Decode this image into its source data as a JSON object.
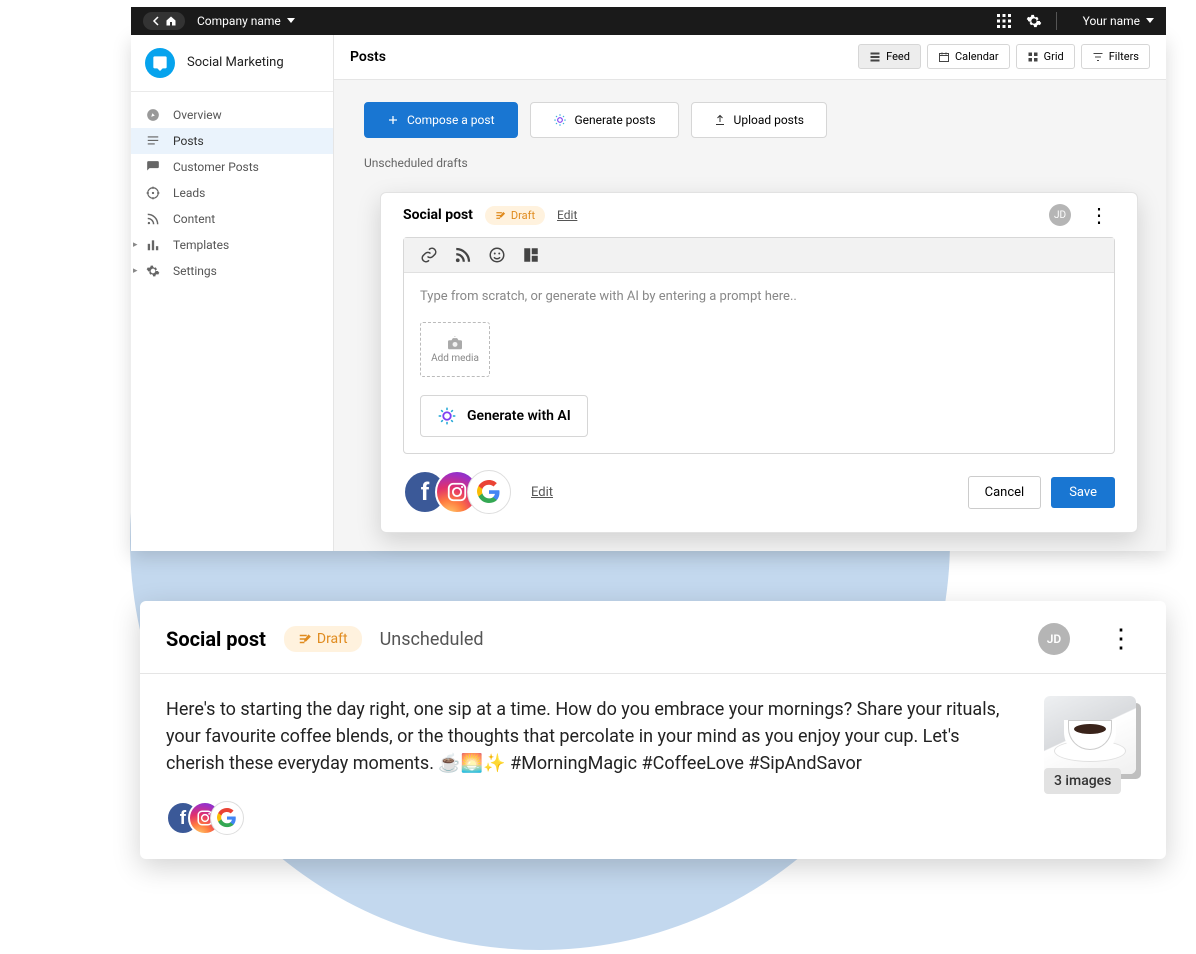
{
  "topbar": {
    "company_label": "Company name",
    "user_label": "Your name"
  },
  "sidebar": {
    "app_name": "Social Marketing",
    "items": [
      {
        "label": "Overview"
      },
      {
        "label": "Posts"
      },
      {
        "label": "Customer Posts"
      },
      {
        "label": "Leads"
      },
      {
        "label": "Content"
      },
      {
        "label": "Templates"
      },
      {
        "label": "Settings"
      }
    ]
  },
  "main": {
    "title": "Posts",
    "views": {
      "feed": "Feed",
      "calendar": "Calendar",
      "grid": "Grid",
      "filters": "Filters"
    },
    "actions": {
      "compose": "Compose a post",
      "generate": "Generate posts",
      "upload": "Upload posts"
    },
    "section_label": "Unscheduled drafts"
  },
  "post_card": {
    "title": "Social post",
    "draft_label": "Draft",
    "edit_label": "Edit",
    "avatar_initials": "JD",
    "placeholder": "Type from scratch, or generate with AI by entering a prompt here..",
    "add_media_label": "Add media",
    "generate_ai_label": "Generate with AI",
    "footer_edit": "Edit",
    "cancel_label": "Cancel",
    "save_label": "Save"
  },
  "preview": {
    "title": "Social post",
    "draft_label": "Draft",
    "status": "Unscheduled",
    "avatar_initials": "JD",
    "body_text": "Here's to starting the day right, one sip at a time. How do you embrace your mornings? Share your rituals, your favourite coffee blends, or the thoughts that percolate in your mind as you enjoy your cup. Let's cherish these everyday moments. ☕🌅✨ #MorningMagic #CoffeeLove #SipAndSavor",
    "image_count_label": "3 images"
  }
}
